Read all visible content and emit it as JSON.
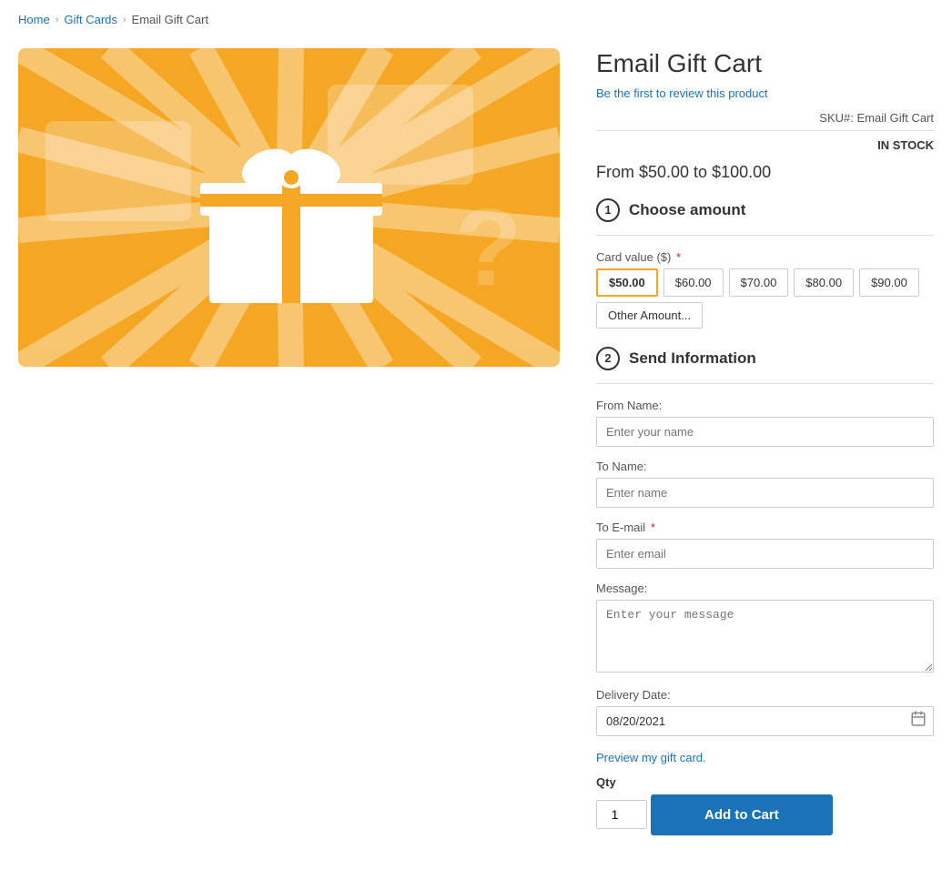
{
  "breadcrumb": {
    "home": "Home",
    "gift_cards": "Gift Cards",
    "current": "Email Gift Cart"
  },
  "product": {
    "title": "Email Gift Cart",
    "review_link": "Be the first to review this product",
    "sku_label": "SKU#:",
    "sku_value": "Email Gift Cart",
    "availability": "IN STOCK",
    "price_range": "From $50.00 to $100.00"
  },
  "choose_amount": {
    "section_number": "1",
    "section_title": "Choose amount",
    "card_value_label": "Card value ($)",
    "options": [
      {
        "label": "$50.00",
        "selected": true
      },
      {
        "label": "$60.00",
        "selected": false
      },
      {
        "label": "$70.00",
        "selected": false
      },
      {
        "label": "$80.00",
        "selected": false
      },
      {
        "label": "$90.00",
        "selected": false
      },
      {
        "label": "Other Amount...",
        "selected": false
      }
    ]
  },
  "send_information": {
    "section_number": "2",
    "section_title": "Send Information",
    "from_name_label": "From Name:",
    "from_name_placeholder": "Enter your name",
    "to_name_label": "To Name:",
    "to_name_placeholder": "Enter name",
    "to_email_label": "To E-mail",
    "to_email_placeholder": "Enter email",
    "message_label": "Message:",
    "message_placeholder": "Enter your message",
    "delivery_date_label": "Delivery Date:",
    "delivery_date_value": "08/20/2021",
    "preview_link": "Preview my gift card.",
    "qty_label": "Qty",
    "qty_value": "1",
    "add_to_cart": "Add to Cart"
  },
  "icons": {
    "chevron": "›",
    "calendar": "📅"
  }
}
